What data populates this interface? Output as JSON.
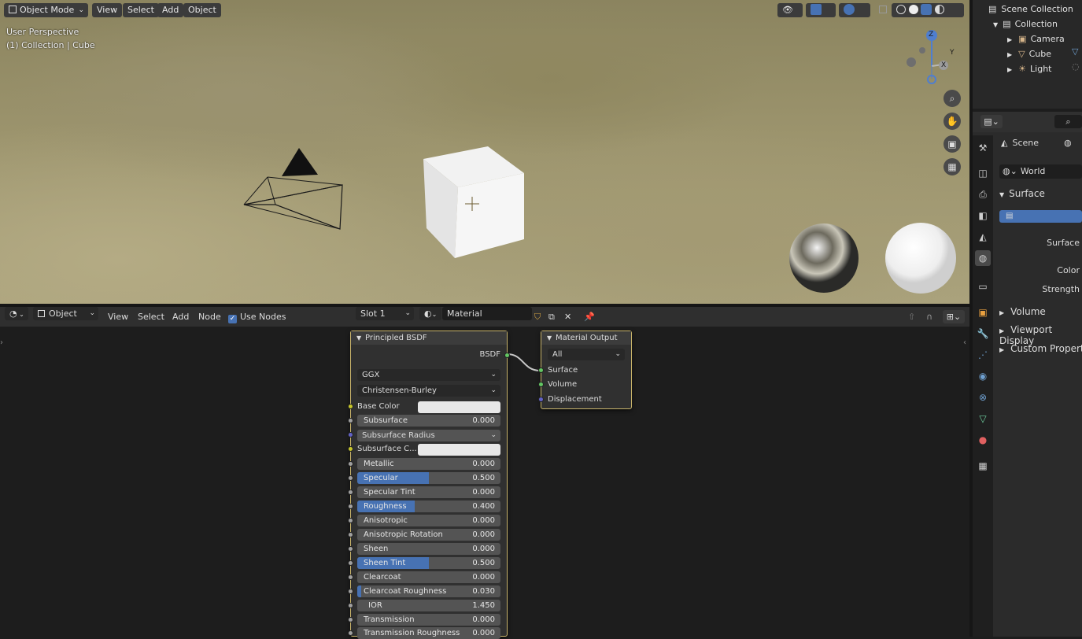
{
  "viewport": {
    "mode_label": "Object Mode",
    "menu": [
      "View",
      "Select",
      "Add",
      "Object"
    ],
    "overlay_line1": "User Perspective",
    "overlay_line2": "(1) Collection | Cube",
    "gizmo": {
      "z": "Z",
      "y": "Y",
      "x": "X"
    },
    "nav_icons": [
      "zoom-icon",
      "pan-hand-icon",
      "camera-view-icon",
      "grid-view-icon"
    ]
  },
  "node_editor": {
    "header": {
      "editor_type_icon": "node-editor-icon",
      "object_dropdown": "Object",
      "menu": [
        "View",
        "Select",
        "Add",
        "Node"
      ],
      "use_nodes_label": "Use Nodes",
      "use_nodes_checked": true,
      "slot_dropdown": "Slot 1",
      "material_name": "Material"
    },
    "principled": {
      "title": "Principled BSDF",
      "output_label": "BSDF",
      "distribution": "GGX",
      "subsurface_method": "Christensen-Burley",
      "base_color_label": "Base Color",
      "subsurface_color_label": "Subsurface C...",
      "subsurface_radius_label": "Subsurface Radius",
      "fields": [
        {
          "label": "Subsurface",
          "value": "0.000",
          "fill": 0
        },
        {
          "label": "Metallic",
          "value": "0.000",
          "fill": 0
        },
        {
          "label": "Specular",
          "value": "0.500",
          "fill": 0.5
        },
        {
          "label": "Specular Tint",
          "value": "0.000",
          "fill": 0
        },
        {
          "label": "Roughness",
          "value": "0.400",
          "fill": 0.4
        },
        {
          "label": "Anisotropic",
          "value": "0.000",
          "fill": 0
        },
        {
          "label": "Anisotropic Rotation",
          "value": "0.000",
          "fill": 0
        },
        {
          "label": "Sheen",
          "value": "0.000",
          "fill": 0
        },
        {
          "label": "Sheen Tint",
          "value": "0.500",
          "fill": 0.5
        },
        {
          "label": "Clearcoat",
          "value": "0.000",
          "fill": 0
        },
        {
          "label": "Clearcoat Roughness",
          "value": "0.030",
          "fill": 0.03
        },
        {
          "label": "IOR",
          "value": "1.450",
          "fill": 0
        },
        {
          "label": "Transmission",
          "value": "0.000",
          "fill": 0
        },
        {
          "label": "Transmission Roughness",
          "value": "0.000",
          "fill": 0
        }
      ]
    },
    "output": {
      "title": "Material Output",
      "target": "All",
      "inputs": [
        "Surface",
        "Volume",
        "Displacement"
      ]
    }
  },
  "outliner": {
    "root": "Scene Collection",
    "collection": "Collection",
    "items": [
      "Camera",
      "Cube",
      "Light"
    ]
  },
  "properties": {
    "scene_label": "Scene",
    "world_label": "World",
    "surface_section": "Surface",
    "surface_label": "Surface",
    "color_label": "Color",
    "strength_label": "Strength",
    "sections": [
      "Volume",
      "Viewport Display",
      "Custom Propertie"
    ]
  }
}
